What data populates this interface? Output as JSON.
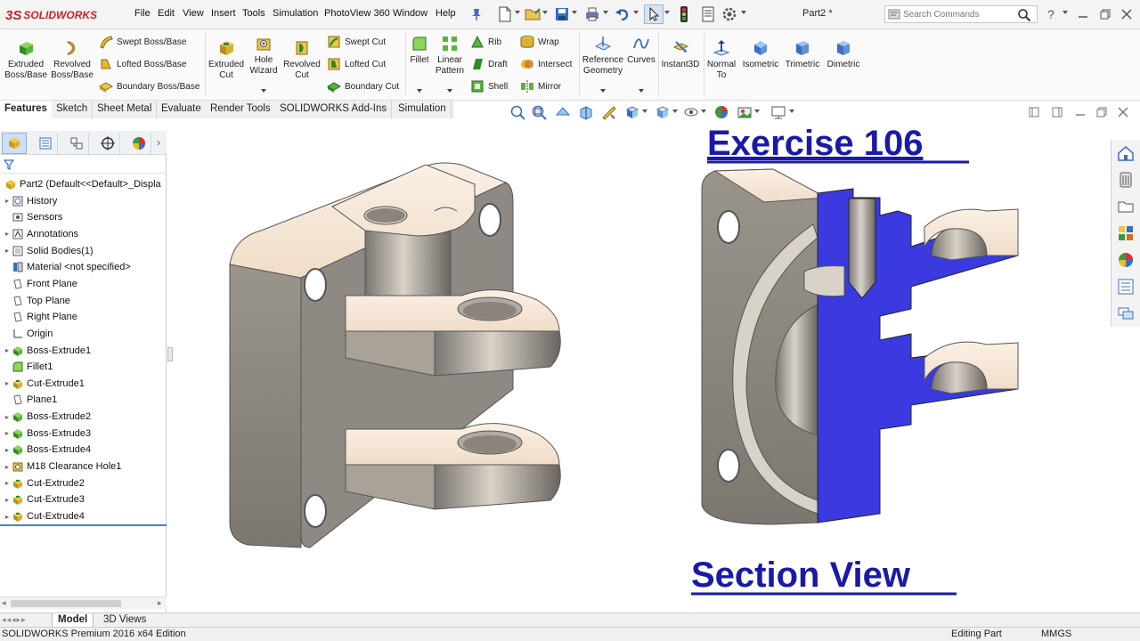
{
  "app": {
    "logo_ds": "3S",
    "logo_text": "SOLIDWORKS",
    "doc_title": "Part2 *"
  },
  "menu": [
    "File",
    "Edit",
    "View",
    "Insert",
    "Tools",
    "Simulation",
    "PhotoView 360",
    "Window",
    "Help"
  ],
  "search": {
    "placeholder": "Search Commands"
  },
  "help_label": "?",
  "commands": {
    "extruded_boss": "Extruded Boss/Base",
    "revolved_boss": "Revolved Boss/Base",
    "swept_boss": "Swept Boss/Base",
    "lofted_boss": "Lofted Boss/Base",
    "boundary_boss": "Boundary Boss/Base",
    "extruded_cut": "Extruded Cut",
    "hole_wizard": "Hole Wizard",
    "revolved_cut": "Revolved Cut",
    "swept_cut": "Swept Cut",
    "lofted_cut": "Lofted Cut",
    "boundary_cut": "Boundary Cut",
    "fillet": "Fillet",
    "linear_pattern": "Linear Pattern",
    "rib": "Rib",
    "draft": "Draft",
    "shell": "Shell",
    "wrap": "Wrap",
    "intersect": "Intersect",
    "mirror": "Mirror",
    "reference_geometry": "Reference Geometry",
    "curves": "Curves",
    "instant3d": "Instant3D",
    "normal_to": "Normal To",
    "isometric": "Isometric",
    "trimetric": "Trimetric",
    "dimetric": "Dimetric"
  },
  "tabs": [
    "Features",
    "Sketch",
    "Sheet Metal",
    "Evaluate",
    "Render Tools",
    "SOLIDWORKS Add-Ins",
    "Simulation"
  ],
  "tree": [
    {
      "label": "Part2  (Default<<Default>_Displa",
      "icon": "part-icon",
      "expand": false
    },
    {
      "label": "History",
      "icon": "history-icon",
      "expand": true
    },
    {
      "label": "Sensors",
      "icon": "sensors-icon",
      "expand": false
    },
    {
      "label": "Annotations",
      "icon": "annotations-icon",
      "expand": true
    },
    {
      "label": "Solid Bodies(1)",
      "icon": "solid-bodies-icon",
      "expand": true
    },
    {
      "label": "Material <not specified>",
      "icon": "material-icon",
      "expand": false
    },
    {
      "label": "Front Plane",
      "icon": "plane-icon",
      "expand": false
    },
    {
      "label": "Top Plane",
      "icon": "plane-icon",
      "expand": false
    },
    {
      "label": "Right Plane",
      "icon": "plane-icon",
      "expand": false
    },
    {
      "label": "Origin",
      "icon": "origin-icon",
      "expand": false
    },
    {
      "label": "Boss-Extrude1",
      "icon": "boss-extrude-icon",
      "expand": true
    },
    {
      "label": "Fillet1",
      "icon": "fillet-icon",
      "expand": false
    },
    {
      "label": "Cut-Extrude1",
      "icon": "cut-extrude-icon",
      "expand": true
    },
    {
      "label": "Plane1",
      "icon": "plane-icon",
      "expand": false
    },
    {
      "label": "Boss-Extrude2",
      "icon": "boss-extrude-icon",
      "expand": true
    },
    {
      "label": "Boss-Extrude3",
      "icon": "boss-extrude-icon",
      "expand": true
    },
    {
      "label": "Boss-Extrude4",
      "icon": "boss-extrude-icon",
      "expand": true
    },
    {
      "label": "M18 Clearance Hole1",
      "icon": "hole-icon",
      "expand": true
    },
    {
      "label": "Cut-Extrude2",
      "icon": "cut-extrude-icon",
      "expand": true
    },
    {
      "label": "Cut-Extrude3",
      "icon": "cut-extrude-icon",
      "expand": true
    },
    {
      "label": "Cut-Extrude4",
      "icon": "cut-extrude-icon",
      "expand": true
    }
  ],
  "graphics": {
    "title": "Exercise 106",
    "subtitle": "Section View",
    "section_color": "#3a3ae0",
    "metal_color": "#8a847c",
    "face_color": "#f5e6d6"
  },
  "model_tabs": [
    "Model",
    "3D Views"
  ],
  "status": {
    "edition": "SOLIDWORKS Premium 2016 x64 Edition",
    "mode": "Editing Part",
    "units": "MMGS"
  }
}
